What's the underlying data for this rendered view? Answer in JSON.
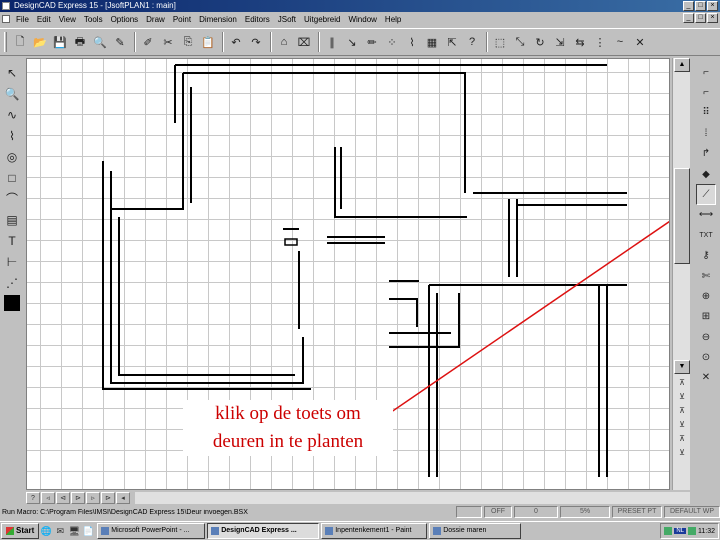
{
  "window": {
    "title": "DesignCAD Express 15 - [JsoftPLAN1 : main]",
    "controls": [
      "_",
      "□",
      "×"
    ],
    "mdi_controls": [
      "_",
      "□",
      "×"
    ]
  },
  "menu": [
    "File",
    "Edit",
    "View",
    "Tools",
    "Options",
    "Draw",
    "Point",
    "Dimension",
    "Editors",
    "JSoft",
    "Uitgebreid",
    "Window",
    "Help"
  ],
  "toolbar": {
    "icons": [
      "new-file-icon",
      "open-folder-icon",
      "save-icon",
      "print-icon",
      "print-preview-icon",
      "draw-icon",
      "edit-icon",
      "cut-icon",
      "copy-icon",
      "paste-icon",
      "undo-icon",
      "redo-icon",
      "door-icon",
      "window-icon",
      "parallel-lines-icon",
      "arrow-icon",
      "pencil-icon",
      "snap-points-icon",
      "tool-icon",
      "block-icon",
      "select-icon",
      "help-icon",
      "select-all-icon",
      "move-icon",
      "rotate-icon",
      "scale-icon",
      "mirror-icon",
      "array-icon",
      "curve-icon",
      "delete-icon"
    ],
    "glyphs": [
      "🗋",
      "📂",
      "💾",
      "🖶",
      "🔍",
      "✎",
      "✐",
      "✂",
      "⎘",
      "📋",
      "↶",
      "↷",
      "⌂",
      "⌧",
      "∥",
      "↘",
      "✏",
      "⁘",
      "⌇",
      "▦",
      "⇱",
      "?",
      "⬚",
      "⤡",
      "↻",
      "⇲",
      "⇆",
      "⋮",
      "~",
      "✕"
    ]
  },
  "left_toolbox": {
    "icons": [
      "select-arrow-icon",
      "zoom-icon",
      "curve-icon",
      "spline-icon",
      "circle-icon",
      "rectangle-icon",
      "polyline-icon",
      "hatch-icon",
      "text-icon",
      "dimension-icon",
      "dotted-line-icon"
    ],
    "glyphs": [
      "↖",
      "🔍",
      "∿",
      "⌇",
      "◎",
      "□",
      "⌒",
      "▤",
      "T",
      "⊢",
      "⋰"
    ]
  },
  "right_toolbox": {
    "icons": [
      "corner-wall-icon",
      "wall-icon",
      "stairs-icon",
      "column-icon",
      "arc-door-icon",
      "eraser-icon",
      "door-tool-icon",
      "measure-icon",
      "text-tool-icon",
      "key-icon",
      "scissors-icon",
      "zoom-in-icon",
      "zoom-window-icon",
      "zoom-out-icon",
      "zoom-fit-icon",
      "close-tool-icon"
    ],
    "glyphs": [
      "⌐",
      "⌐",
      "⠿",
      "⁞",
      "↱",
      "◆",
      "⟋",
      "⟷",
      "TXT",
      "⚷",
      "✄",
      "⊕",
      "⊞",
      "⊖",
      "⊙",
      "✕"
    ]
  },
  "annotation": {
    "line1": "klik op de toets om",
    "line2": "deuren in te planten",
    "color": "#cc0000"
  },
  "statusbar": {
    "path": "Run Macro: C:\\Program Files\\IMSI\\DesignCAD Express 15\\Deur invoegen.BSX",
    "cells": [
      "",
      "OFF",
      "0",
      "5%",
      "PRESET PT",
      "DEFAULT WP"
    ]
  },
  "taskbar": {
    "start": "Start",
    "quicklaunch": [
      "🌐",
      "✉",
      "🖥",
      "📄"
    ],
    "tasks": [
      {
        "label": "Microsoft PowerPoint - ...",
        "active": false
      },
      {
        "label": "DesignCAD Express ...",
        "active": true
      },
      {
        "label": "Inpentenkement1 - Paint",
        "active": false
      },
      {
        "label": "Dossie maren",
        "active": false
      }
    ],
    "tray": {
      "lang": "NL",
      "clock": "11:32"
    }
  },
  "colors": {
    "titlebar": "#0a246a",
    "face": "#c0c0c0",
    "annotation": "#cc0000"
  }
}
